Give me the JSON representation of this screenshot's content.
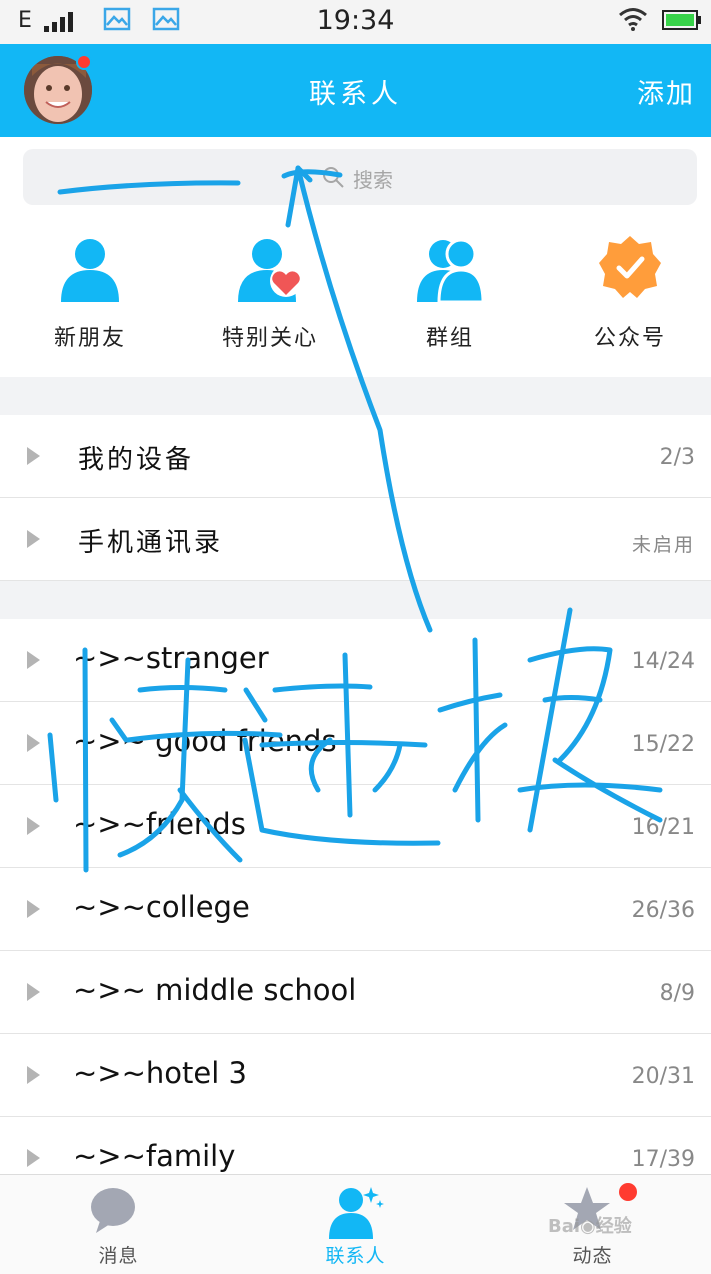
{
  "status_bar": {
    "network": "E",
    "time": "19:34"
  },
  "header": {
    "title": "联系人",
    "add_label": "添加"
  },
  "search": {
    "placeholder": "搜索"
  },
  "quick_entries": [
    {
      "label": "新朋友",
      "icon": "new-friend-icon"
    },
    {
      "label": "特别关心",
      "icon": "special-care-icon"
    },
    {
      "label": "群组",
      "icon": "group-icon"
    },
    {
      "label": "公众号",
      "icon": "official-account-icon"
    }
  ],
  "fixed_rows": [
    {
      "name": "我的设备",
      "count": "2/3"
    },
    {
      "name": "手机通讯录",
      "count": "未启用"
    }
  ],
  "groups": [
    {
      "name": "~>~stranger",
      "count": "14/24"
    },
    {
      "name": "~>~ good friends",
      "count": "15/22"
    },
    {
      "name": "~>~friends",
      "count": "16/21"
    },
    {
      "name": "~>~college",
      "count": "26/36"
    },
    {
      "name": "~>~ middle school",
      "count": "8/9"
    },
    {
      "name": "~>~hotel 3",
      "count": "20/31"
    },
    {
      "name": "~>~family",
      "count": "17/39"
    }
  ],
  "tabs": [
    {
      "label": "消息",
      "icon": "message-icon"
    },
    {
      "label": "联系人",
      "icon": "contacts-icon"
    },
    {
      "label": "动态",
      "icon": "moments-icon"
    }
  ],
  "colors": {
    "accent": "#12b7f5",
    "badge": "#ff3b30",
    "annotation": "#1aa3e8"
  }
}
